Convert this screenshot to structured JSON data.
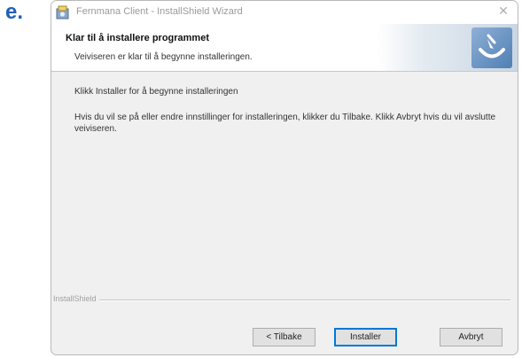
{
  "step_label": "e.",
  "window": {
    "title": "Fernmana Client - InstallShield Wizard",
    "close_glyph": "✕"
  },
  "banner": {
    "title": "Klar til å installere programmet",
    "subtitle": "Veiviseren er klar til å begynne installeringen.",
    "logo_icon": "installshield-logo-icon"
  },
  "content": {
    "instruction": "Klikk Installer for å begynne installeringen",
    "body": "Hvis du vil se på eller endre innstillinger for installeringen, klikker du Tilbake. Klikk Avbryt hvis du vil avslutte veiviseren."
  },
  "footer": {
    "brand": "InstallShield",
    "back_label": "< Tilbake",
    "install_label": "Installer",
    "cancel_label": "Avbryt"
  },
  "colors": {
    "step_letter": "#1f5fb8",
    "primary_border": "#0078d7",
    "dialog_bg": "#f0f0f0"
  }
}
